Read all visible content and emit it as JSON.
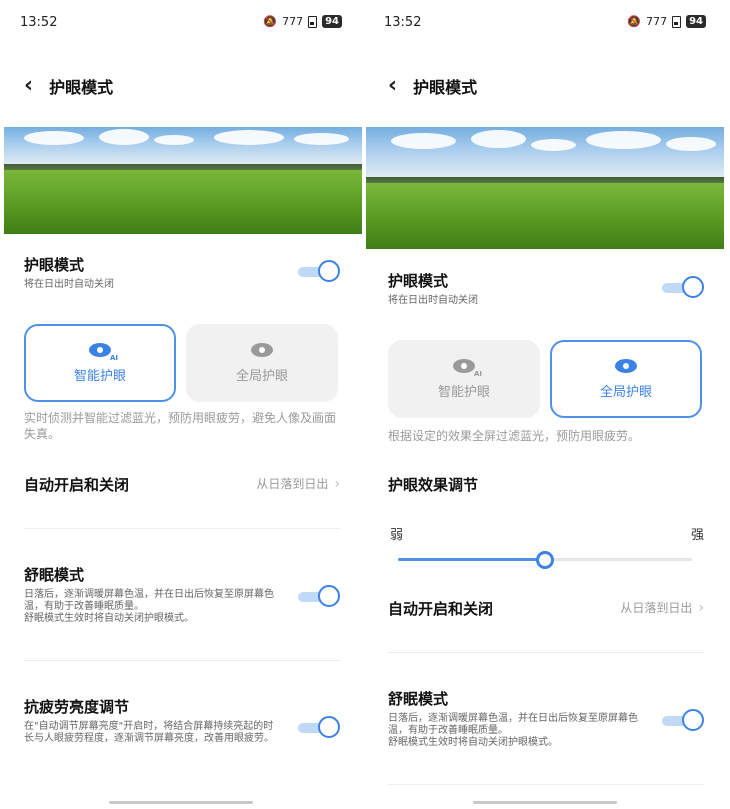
{
  "status": {
    "time": "13:52",
    "signal": "777",
    "battery": "94"
  },
  "left": {
    "header_title": "护眼模式",
    "eye_mode": {
      "title": "护眼模式",
      "subtitle": "将在日出时自动关闭",
      "enabled": true
    },
    "cards": [
      {
        "label": "智能护眼",
        "selected": true
      },
      {
        "label": "全局护眼",
        "selected": false
      }
    ],
    "description": "实时侦测并智能过滤蓝光，预防用眼疲劳，避免人像及画面失真。",
    "auto": {
      "title": "自动开启和关闭",
      "value": "从日落到日出"
    },
    "sleep": {
      "title": "舒眠模式",
      "subtitle": "日落后，逐渐调暖屏幕色温，并在日出后恢复至原屏幕色温，有助于改善睡眠质量。\n舒眠模式生效时将自动关闭护眼模式。",
      "enabled": true
    },
    "anti_fatigue": {
      "title": "抗疲劳亮度调节",
      "subtitle": "在\"自动调节屏幕亮度\"开启时，将结合屏幕持续亮起的时长与人眼疲劳程度，逐渐调节屏幕亮度，改善用眼疲劳。",
      "enabled": true
    }
  },
  "right": {
    "header_title": "护眼模式",
    "eye_mode": {
      "title": "护眼模式",
      "subtitle": "将在日出时自动关闭",
      "enabled": true
    },
    "cards": [
      {
        "label": "智能护眼",
        "selected": false
      },
      {
        "label": "全局护眼",
        "selected": true
      }
    ],
    "description": "根据设定的效果全屏过滤蓝光，预防用眼疲劳。",
    "effect": {
      "title": "护眼效果调节",
      "weak": "弱",
      "strong": "强",
      "level": 0.5
    },
    "auto": {
      "title": "自动开启和关闭",
      "value": "从日落到日出"
    },
    "sleep": {
      "title": "舒眠模式",
      "subtitle": "日落后，逐渐调暖屏幕色温，并在日出后恢复至原屏幕色温，有助于改善睡眠质量。\n舒眠模式生效时将自动关闭护眼模式。",
      "enabled": true
    }
  },
  "colors": {
    "accent": "#3b82e6",
    "toggle_track": "#bfd9f7",
    "card_inactive": "#f1f1f1"
  }
}
